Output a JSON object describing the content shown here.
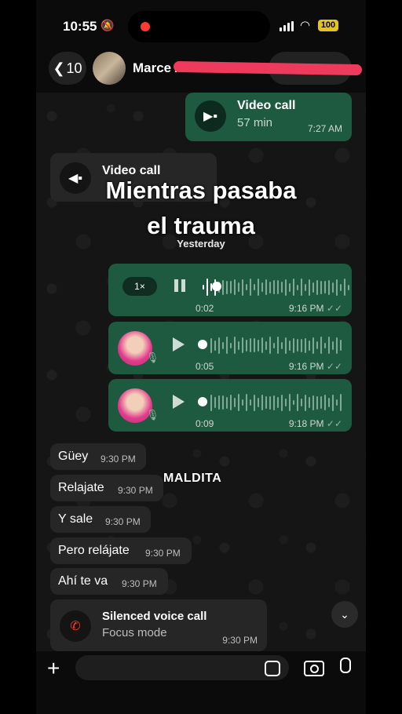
{
  "status": {
    "time": "10:55",
    "battery": "100"
  },
  "header": {
    "back_count": "10",
    "contact_name": "Marce A"
  },
  "overlay": {
    "line1": "Mientras pasaba",
    "line2": "el trauma"
  },
  "messages": {
    "call_out": {
      "title": "Video call",
      "duration": "57 min",
      "time": "7:27 AM"
    },
    "call_in": {
      "title": "Video call"
    },
    "day_chip": "Yesterday",
    "voice": [
      {
        "speed": "1×",
        "duration": "0:02",
        "time": "9:16 PM",
        "progress": 0.12
      },
      {
        "duration": "0:05",
        "time": "9:16 PM",
        "progress": 0
      },
      {
        "duration": "0:09",
        "time": "9:18 PM",
        "progress": 0
      }
    ],
    "texts": [
      {
        "text": "Güey",
        "time": "9:30 PM"
      },
      {
        "text": "Relajate",
        "time": "9:30 PM"
      },
      {
        "text": "Y sale",
        "time": "9:30 PM"
      },
      {
        "text": "Pero relájate",
        "time": "9:30 PM"
      },
      {
        "text": "Ahí te va",
        "time": "9:30 PM"
      }
    ],
    "silenced": {
      "title": "Silenced voice call",
      "subtitle": "Focus mode",
      "time": "9:30 PM"
    }
  },
  "sticker_text": "MALDITA",
  "colors": {
    "outgoing_bubble": "#1d5a3f",
    "incoming_bubble": "#262626",
    "redaction": "#ef3b5b",
    "missed_call": "#ff3b30"
  },
  "icons": [
    "back-chevron-icon",
    "video-camera-icon",
    "play-icon",
    "pause-icon",
    "microphone-icon",
    "missed-call-icon",
    "plus-icon",
    "sticker-icon",
    "camera-icon",
    "chevron-down-icon"
  ]
}
